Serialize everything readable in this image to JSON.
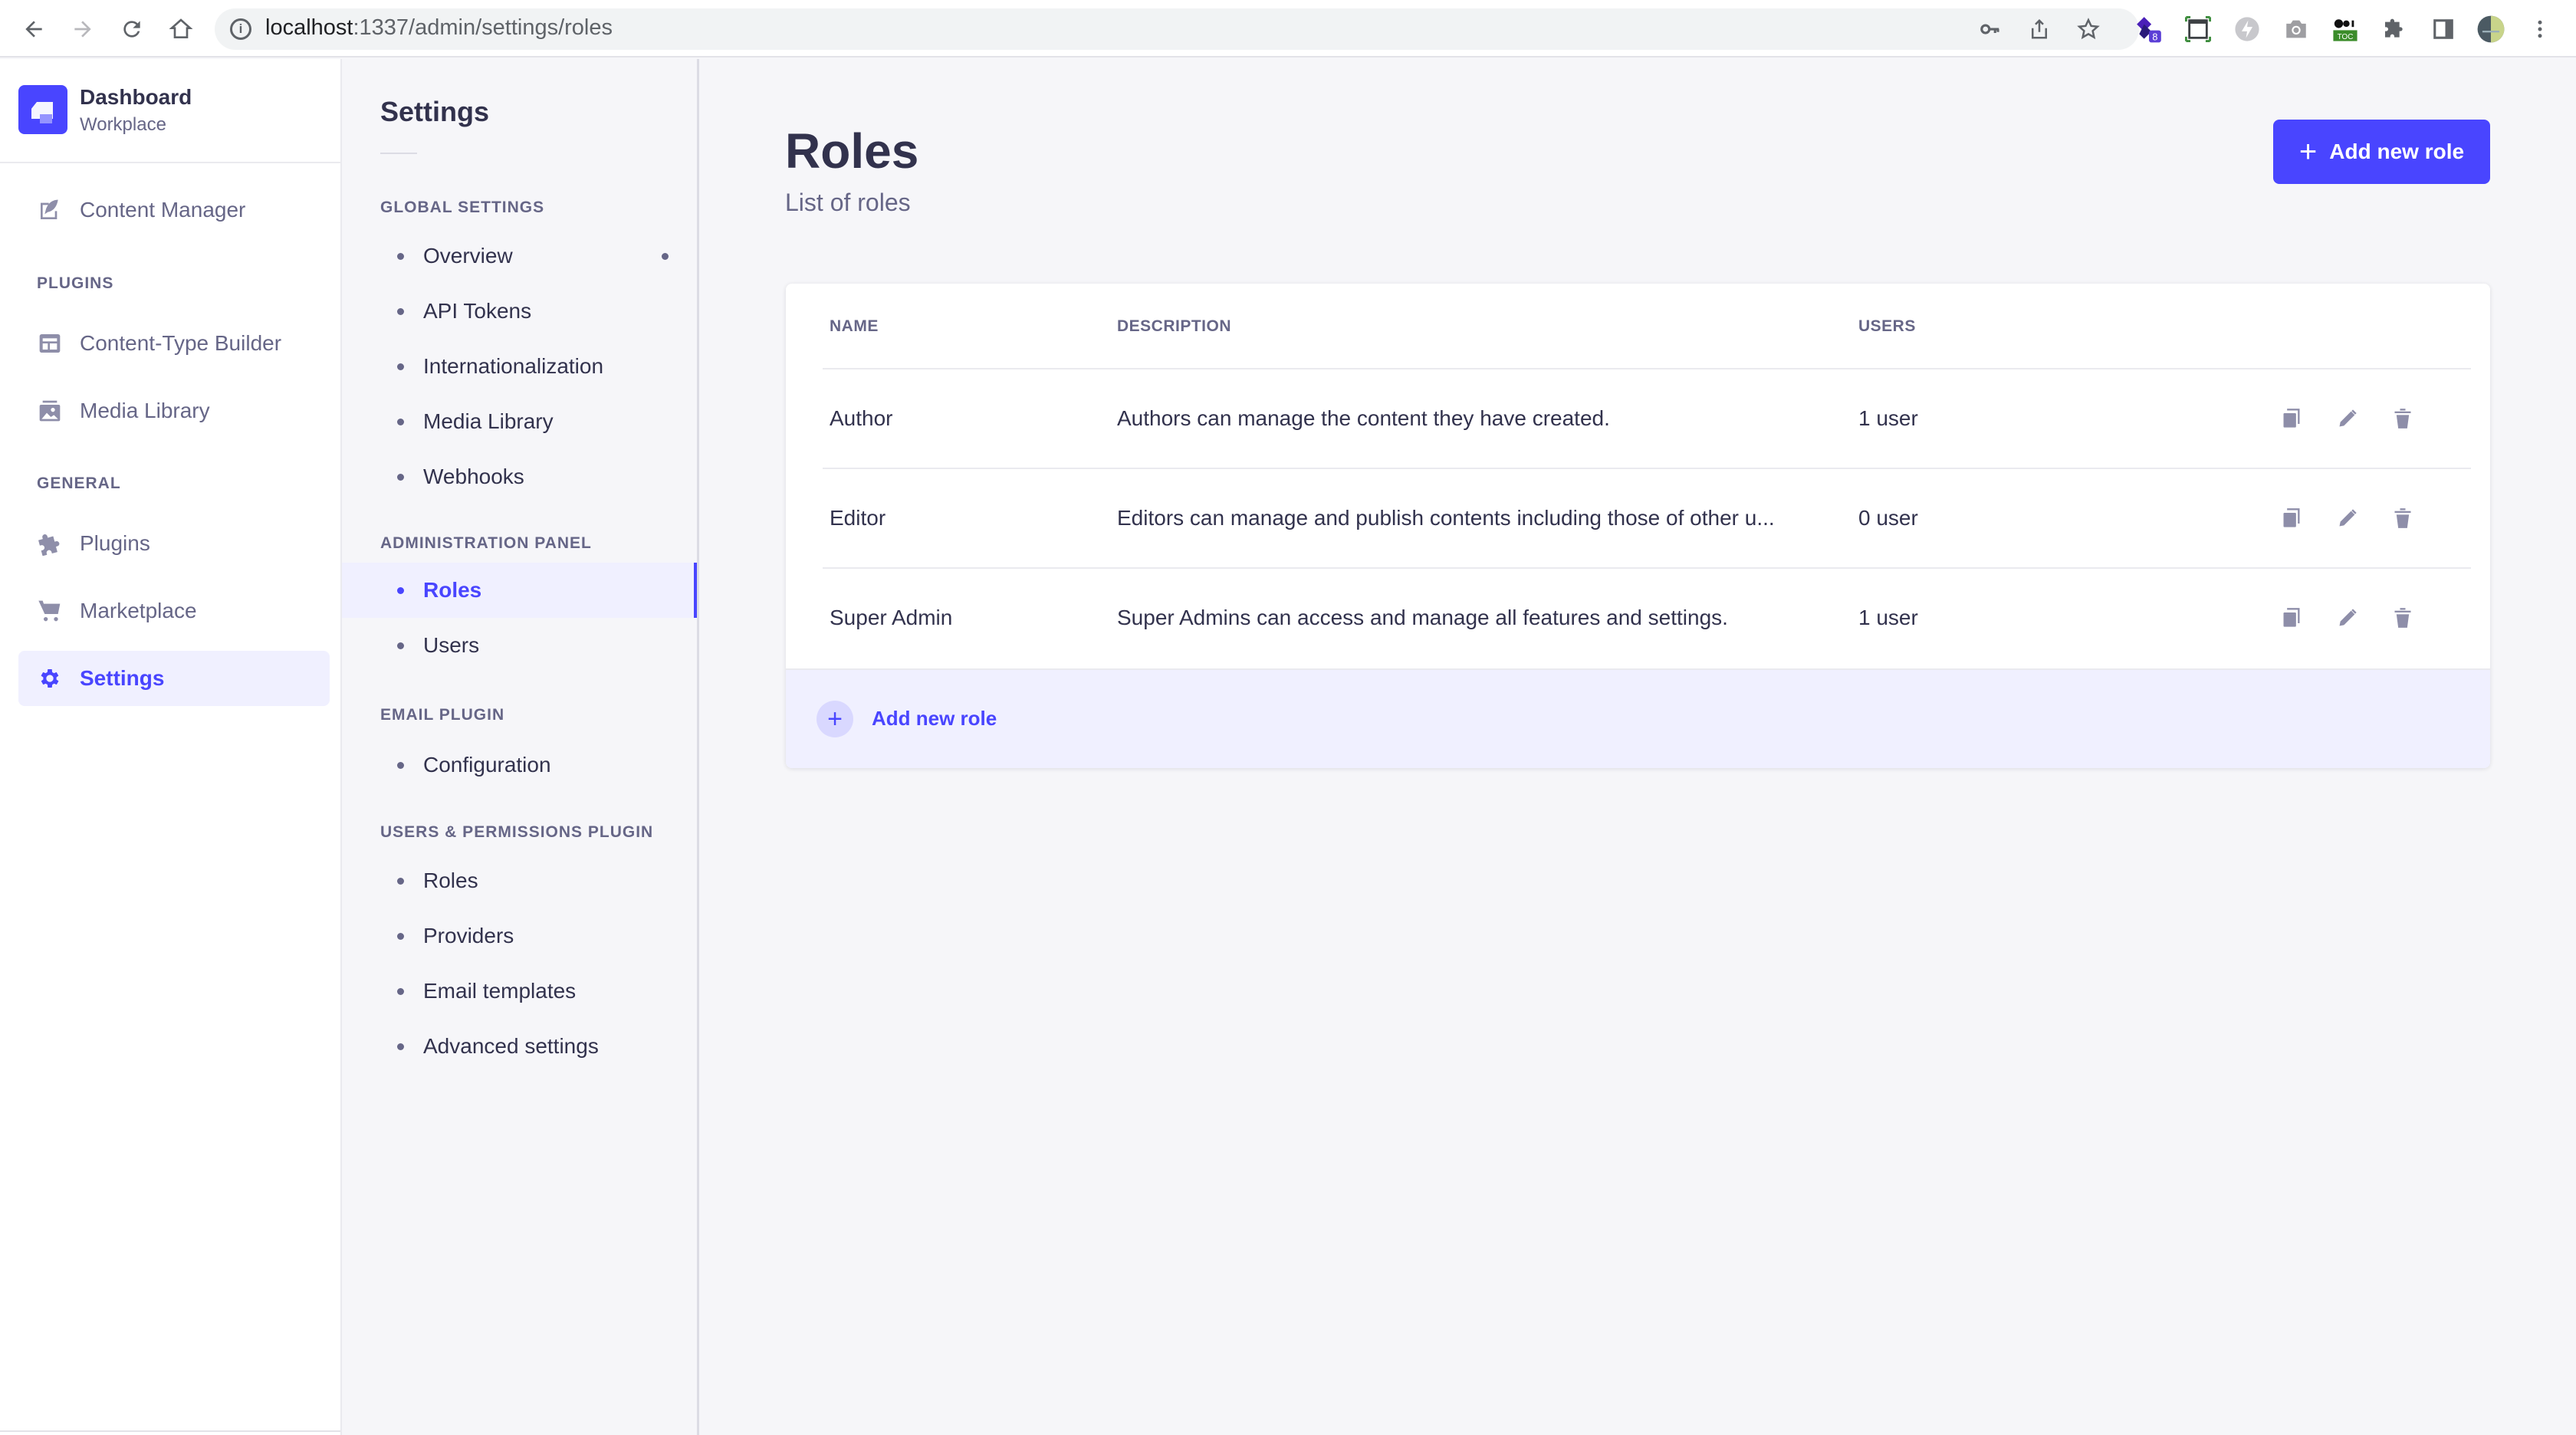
{
  "browser": {
    "url_host": "localhost",
    "url_path": ":1337/admin/settings/roles",
    "extension_badge": "8",
    "toc_label": "TOC"
  },
  "brand": {
    "title": "Dashboard",
    "subtitle": "Workplace",
    "color": "#4945ff"
  },
  "main_nav": {
    "top_item": {
      "label": "Content Manager",
      "icon": "feather-icon"
    },
    "sections": [
      {
        "title": "PLUGINS",
        "items": [
          {
            "label": "Content-Type Builder",
            "icon": "layout-icon"
          },
          {
            "label": "Media Library",
            "icon": "image-icon"
          }
        ]
      },
      {
        "title": "GENERAL",
        "items": [
          {
            "label": "Plugins",
            "icon": "puzzle-icon"
          },
          {
            "label": "Marketplace",
            "icon": "cart-icon"
          },
          {
            "label": "Settings",
            "icon": "gear-icon",
            "active": true
          }
        ]
      }
    ]
  },
  "settings_nav": {
    "title": "Settings",
    "sections": [
      {
        "title": "GLOBAL SETTINGS",
        "items": [
          {
            "label": "Overview",
            "has_indicator": true
          },
          {
            "label": "API Tokens"
          },
          {
            "label": "Internationalization"
          },
          {
            "label": "Media Library"
          },
          {
            "label": "Webhooks"
          }
        ]
      },
      {
        "title": "ADMINISTRATION PANEL",
        "items": [
          {
            "label": "Roles",
            "active": true
          },
          {
            "label": "Users"
          }
        ]
      },
      {
        "title": "EMAIL PLUGIN",
        "items": [
          {
            "label": "Configuration"
          }
        ]
      },
      {
        "title": "USERS & PERMISSIONS PLUGIN",
        "items": [
          {
            "label": "Roles"
          },
          {
            "label": "Providers"
          },
          {
            "label": "Email templates"
          },
          {
            "label": "Advanced settings"
          }
        ]
      }
    ]
  },
  "page": {
    "title": "Roles",
    "subtitle": "List of roles",
    "add_button_label": "Add new role"
  },
  "table": {
    "columns": [
      "NAME",
      "DESCRIPTION",
      "USERS"
    ],
    "rows": [
      {
        "name": "Author",
        "description": "Authors can manage the content they have created.",
        "users": "1 user"
      },
      {
        "name": "Editor",
        "description": "Editors can manage and publish contents including those of other u...",
        "users": "0 user"
      },
      {
        "name": "Super Admin",
        "description": "Super Admins can access and manage all features and settings.",
        "users": "1 user"
      }
    ],
    "row_actions": [
      "duplicate-icon",
      "pencil-icon",
      "trash-icon"
    ],
    "footer_label": "Add new role"
  },
  "colors": {
    "primary": "#4945ff",
    "primary_light": "#f0f0ff",
    "text": "#32324d",
    "muted": "#666687",
    "icon": "#8e8ea9"
  }
}
